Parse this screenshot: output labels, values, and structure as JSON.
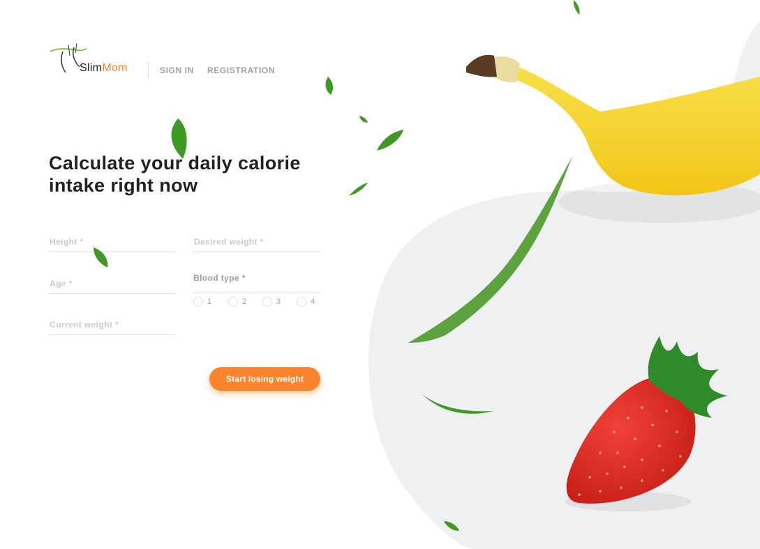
{
  "brand": {
    "logo_slim": "Slim",
    "logo_mom": "Mom"
  },
  "nav": {
    "sign_in": "SIGN IN",
    "registration": "REGISTRATION"
  },
  "hero": {
    "title": "Calculate your daily calorie intake right now"
  },
  "form": {
    "height_placeholder": "Height *",
    "desired_weight_placeholder": "Desired weight *",
    "age_placeholder": "Age *",
    "current_weight_placeholder": "Current weight *",
    "blood_type_label": "Blood type *",
    "blood_types": [
      "1",
      "2",
      "3",
      "4"
    ],
    "submit_label": "Start losing weight"
  },
  "colors": {
    "accent": "#fc842d",
    "heading": "#212121",
    "muted": "#9b9faa",
    "line": "#e0e0e0",
    "blob": "#f0f1f3"
  },
  "icons": [
    "logo-icon",
    "leaf-icon",
    "banana-icon",
    "strawberry-icon"
  ]
}
